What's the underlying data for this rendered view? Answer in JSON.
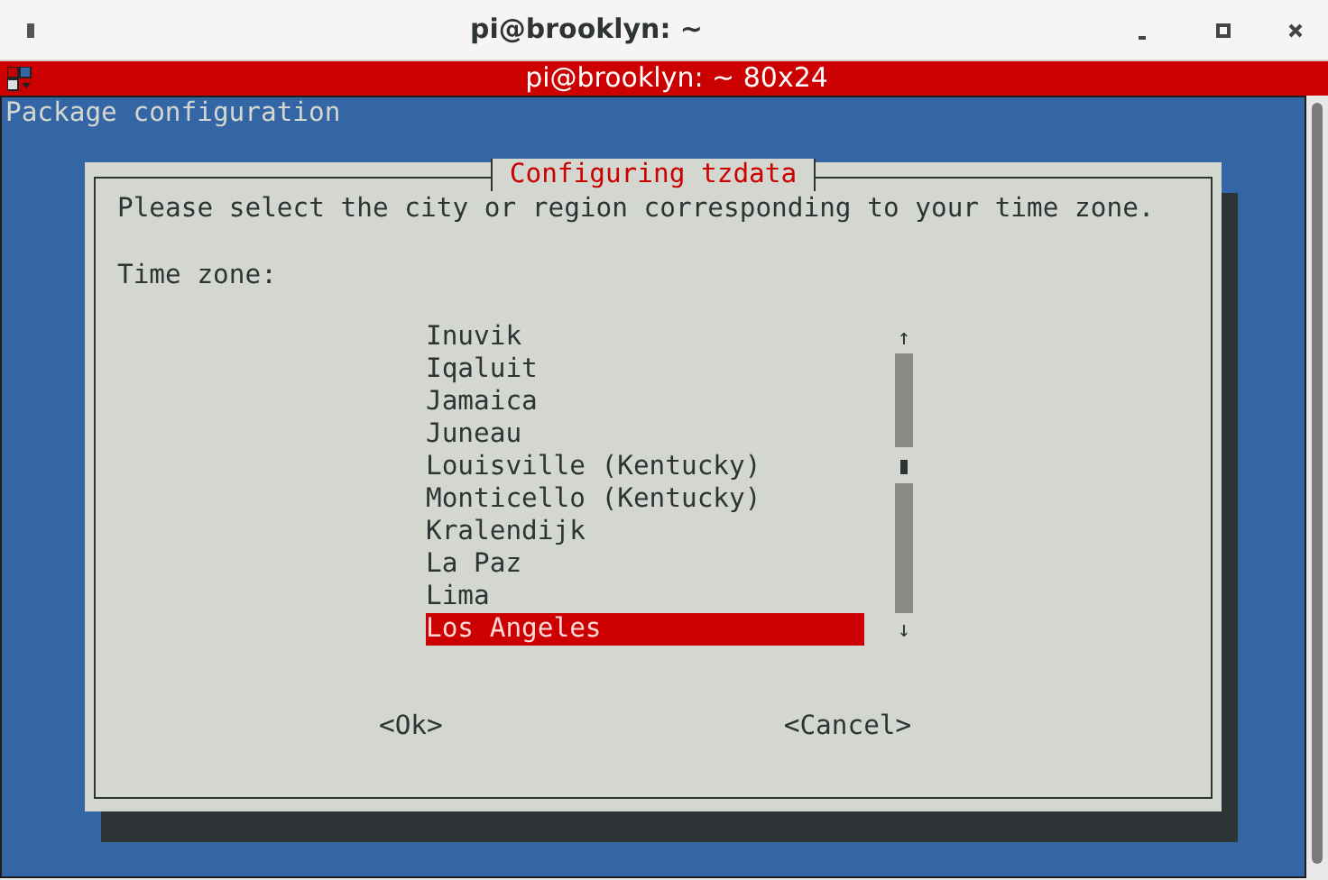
{
  "window": {
    "title": "pi@brooklyn: ~"
  },
  "terminal": {
    "title": "pi@brooklyn: ~ 80x24",
    "header": "Package configuration"
  },
  "dialog": {
    "title": "Configuring tzdata",
    "prompt": "Please select the city or region corresponding to your time zone.",
    "label": "Time zone:",
    "items": [
      {
        "label": "Inuvik",
        "selected": false
      },
      {
        "label": "Iqaluit",
        "selected": false
      },
      {
        "label": "Jamaica",
        "selected": false
      },
      {
        "label": "Juneau",
        "selected": false
      },
      {
        "label": "Louisville (Kentucky)",
        "selected": false
      },
      {
        "label": "Monticello (Kentucky)",
        "selected": false
      },
      {
        "label": "Kralendijk",
        "selected": false
      },
      {
        "label": "La Paz",
        "selected": false
      },
      {
        "label": "Lima",
        "selected": false
      },
      {
        "label": "Los Angeles",
        "selected": true
      }
    ],
    "scroll_up": "↑",
    "scroll_down": "↓",
    "buttons": [
      "<Ok>",
      "<Cancel>"
    ]
  }
}
